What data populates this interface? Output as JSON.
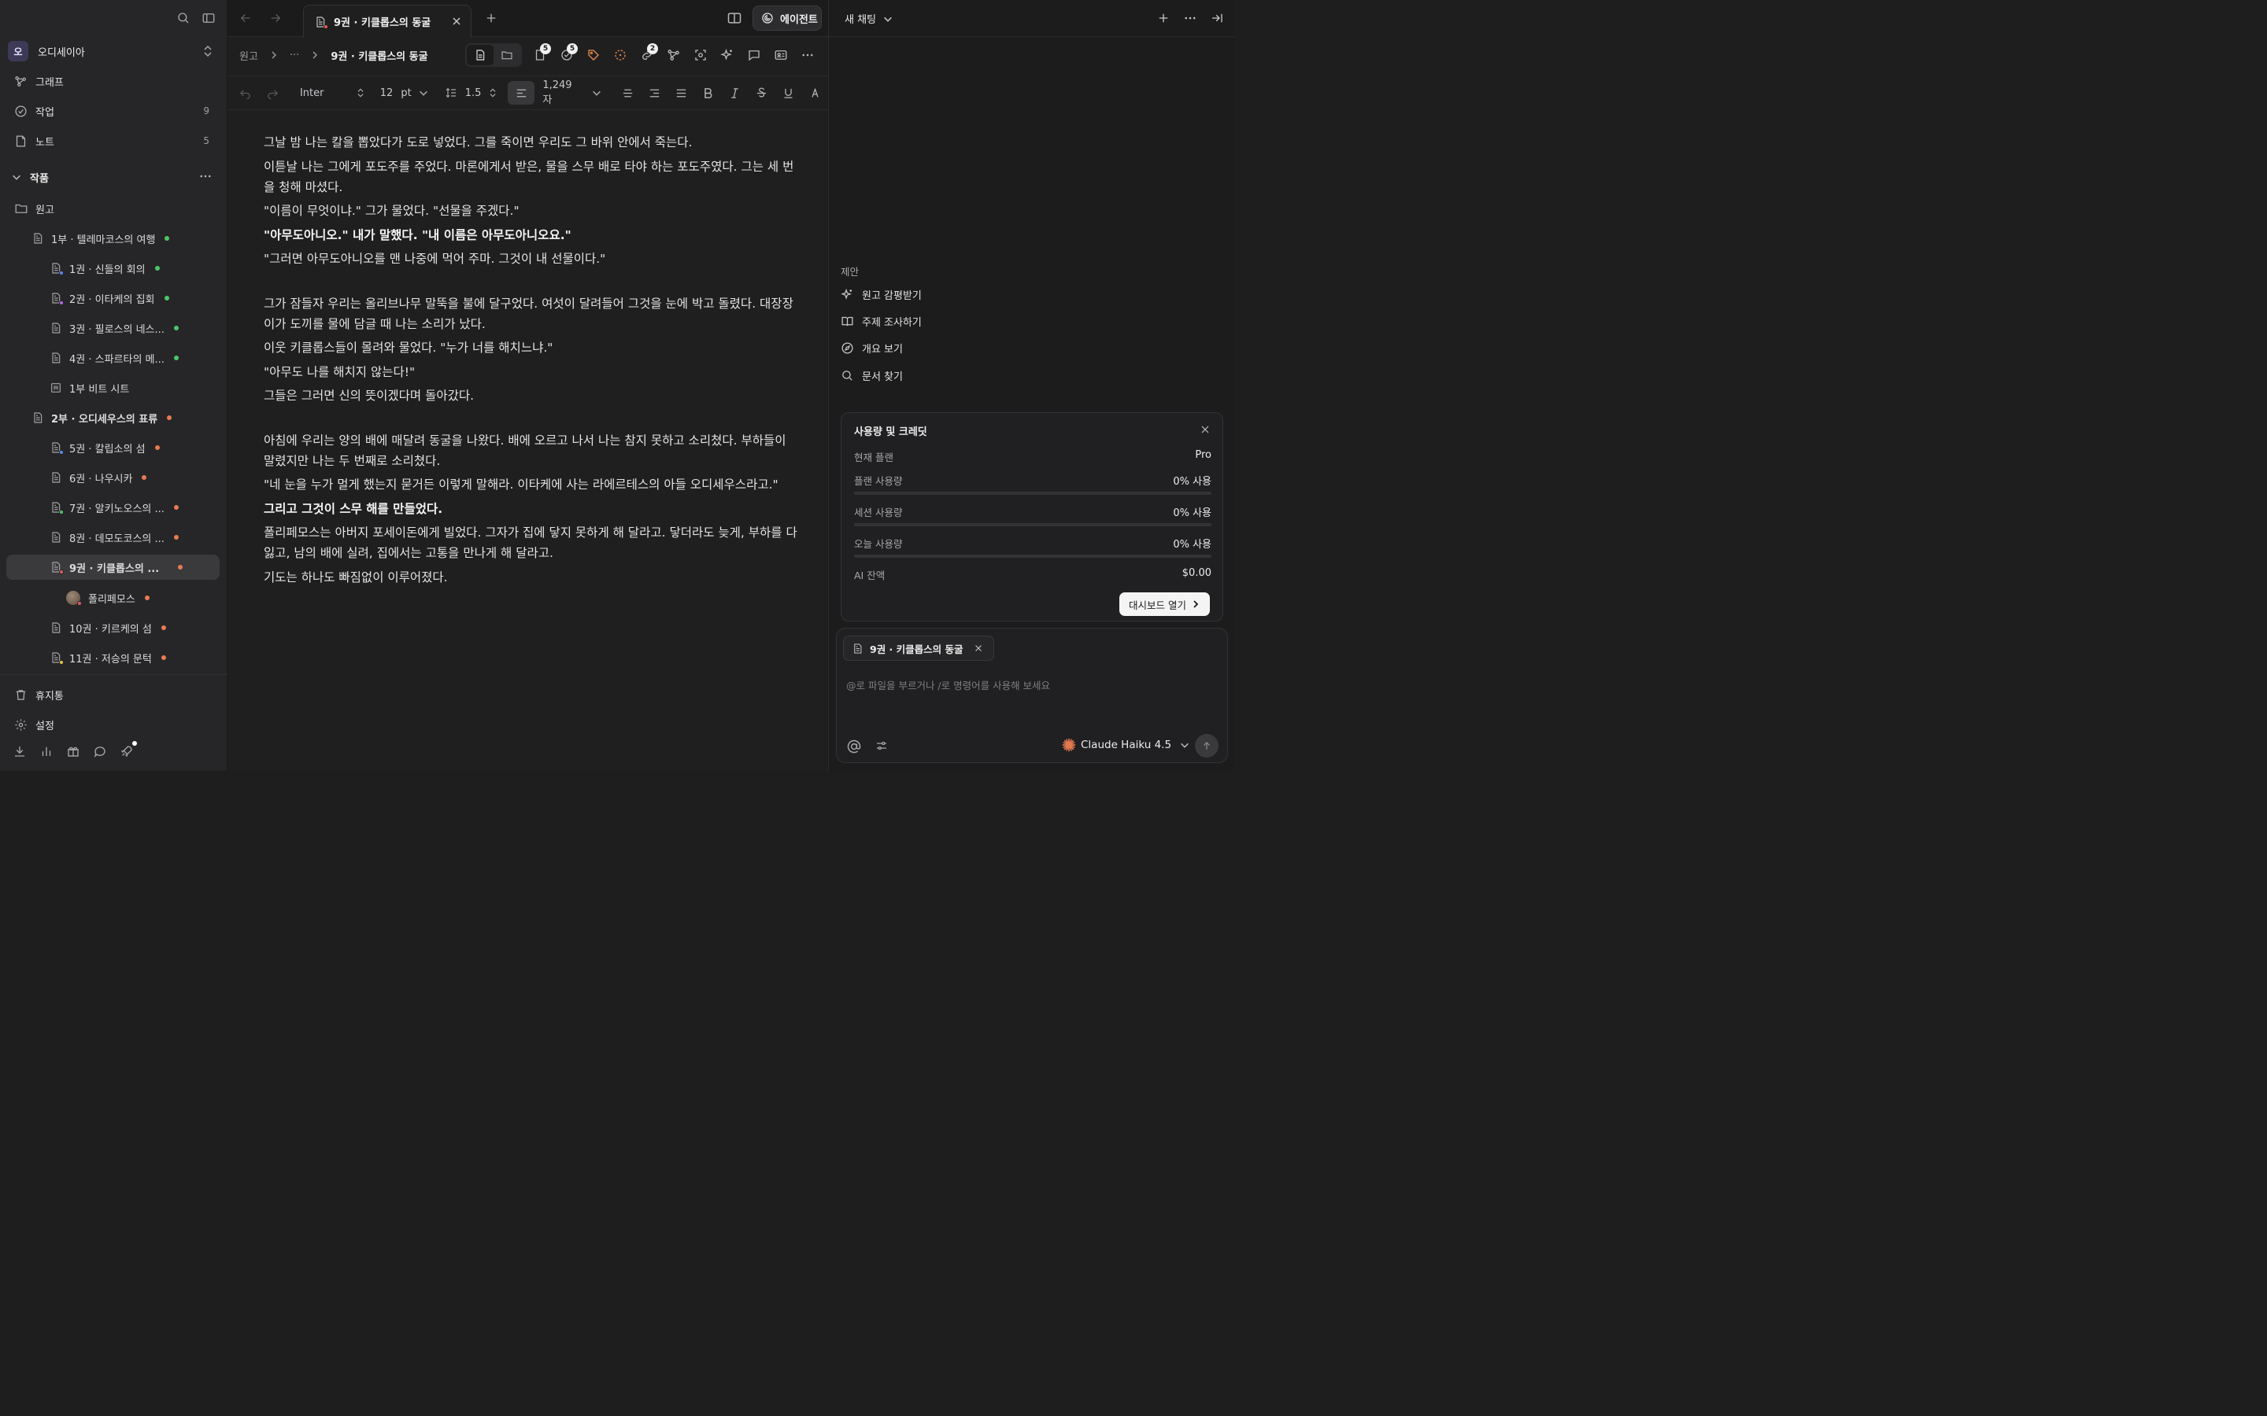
{
  "sidebar": {
    "workspace": {
      "initial": "오",
      "name": "오디세이아"
    },
    "nav": [
      {
        "label": "그래프",
        "count": ""
      },
      {
        "label": "작업",
        "count": "9"
      },
      {
        "label": "노트",
        "count": "5"
      }
    ],
    "section": "작품",
    "tree": [
      {
        "label": "원고"
      },
      {
        "label": "1부 · 텔레마코스의 여행"
      },
      {
        "label": "1권 · 신들의 회의"
      },
      {
        "label": "2권 · 이타케의 집회"
      },
      {
        "label": "3권 · 필로스의 네스..."
      },
      {
        "label": "4권 · 스파르타의 메..."
      },
      {
        "label": "1부 비트 시트"
      },
      {
        "label": "2부 · 오디세우스의 표류"
      },
      {
        "label": "5권 · 칼립소의 섬"
      },
      {
        "label": "6권 · 나우시카"
      },
      {
        "label": "7권 · 알키노오스의 ..."
      },
      {
        "label": "8권 · 데모도코스의 ..."
      },
      {
        "label": "9권 · 키클롭스의 ..."
      },
      {
        "label": "폴리페모스"
      },
      {
        "label": "10권 · 키르케의 섬"
      },
      {
        "label": "11권 · 저승의 문턱"
      }
    ],
    "trash": "휴지통",
    "settings": "설정"
  },
  "editor": {
    "tab_title": "9권 · 키클롭스의 동굴",
    "agent_label": "에이전트",
    "breadcrumb": {
      "root": "원고",
      "ellipsis": "···",
      "current": "9권 · 키클롭스의 동굴"
    },
    "badges": {
      "pages": "5",
      "tasks": "5",
      "links": "2"
    },
    "format": {
      "font": "Inter",
      "size": "12",
      "unit": "pt",
      "line_height": "1.5",
      "char_count": "1,249 자"
    },
    "paragraphs": [
      {
        "text": "그날 밤 나는 칼을 뽑았다가 도로 넣었다. 그를 죽이면 우리도 그 바위 안에서 죽는다.",
        "bold": false
      },
      {
        "text": "이튿날 나는 그에게 포도주를 주었다. 마론에게서 받은, 물을 스무 배로 타야 하는 포도주였다. 그는 세 번을 청해 마셨다.",
        "bold": false
      },
      {
        "text": "\"이름이 무엇이냐.\" 그가 물었다. \"선물을 주겠다.\"",
        "bold": false
      },
      {
        "text": "\"아무도아니오.\" 내가 말했다. \"내 이름은 아무도아니오요.\"",
        "bold": true
      },
      {
        "text": "\"그러면 아무도아니오를 맨 나중에 먹어 주마. 그것이 내 선물이다.\"",
        "bold": false
      },
      {
        "gap": true
      },
      {
        "text": "그가 잠들자 우리는 올리브나무 말뚝을 불에 달구었다. 여섯이 달려들어 그것을 눈에 박고 돌렸다. 대장장이가 도끼를 물에 담글 때 나는 소리가 났다.",
        "bold": false
      },
      {
        "text": "이웃 키클롭스들이 몰려와 물었다. \"누가 너를 해치느냐.\"",
        "bold": false
      },
      {
        "text": "\"아무도 나를 해치지 않는다!\"",
        "bold": false
      },
      {
        "text": "그들은 그러면 신의 뜻이겠다며 돌아갔다.",
        "bold": false
      },
      {
        "gap": true
      },
      {
        "text": "아침에 우리는 양의 배에 매달려 동굴을 나왔다. 배에 오르고 나서 나는 참지 못하고 소리쳤다. 부하들이 말렸지만 나는 두 번째로 소리쳤다.",
        "bold": false
      },
      {
        "text": "\"네 눈을 누가 멀게 했는지 묻거든 이렇게 말해라. 이타케에 사는 라에르테스의 아들 오디세우스라고.\"",
        "bold": false
      },
      {
        "text": "그리고 그것이 스무 해를 만들었다.",
        "bold": true
      },
      {
        "text": "폴리페모스는 아버지 포세이돈에게 빌었다. 그자가 집에 닿지 못하게 해 달라고. 닿더라도 늦게, 부하를 다 잃고, 남의 배에 실려, 집에서는 고통을 만나게 해 달라고.",
        "bold": false
      },
      {
        "text": "기도는 하나도 빠짐없이 이루어졌다.",
        "bold": false
      }
    ]
  },
  "panel": {
    "title": "새 채팅",
    "suggestions_title": "제안",
    "suggestions": [
      {
        "label": "원고 감평받기",
        "icon": "sparkle-icon"
      },
      {
        "label": "주제 조사하기",
        "icon": "book-icon"
      },
      {
        "label": "개요 보기",
        "icon": "compass-icon"
      },
      {
        "label": "문서 찾기",
        "icon": "search-icon"
      }
    ],
    "usage": {
      "title": "사용량 및 크레딧",
      "plan_label": "현재 플랜",
      "plan_value": "Pro",
      "rows": [
        {
          "label": "플랜 사용량",
          "value": "0% 사용",
          "fraction": 0
        },
        {
          "label": "세션 사용량",
          "value": "0% 사용",
          "fraction": 0
        },
        {
          "label": "오늘 사용량",
          "value": "0% 사용",
          "fraction": 0
        }
      ],
      "balance_label": "AI 잔액",
      "balance_value": "$0.00",
      "dashboard_label": "대시보드 열기"
    },
    "composer": {
      "chip_label": "9권 · 키클롭스의 동굴",
      "placeholder": "@로 파일을 부르거나 /로 명령어를 사용해 보세요",
      "model": "Claude Haiku 4.5"
    }
  },
  "colors": {
    "accent": "#6b6bf0",
    "green_dot": "#4cc76a",
    "orange_dot": "#e77b52",
    "claude_spark": "#e07a4f"
  }
}
